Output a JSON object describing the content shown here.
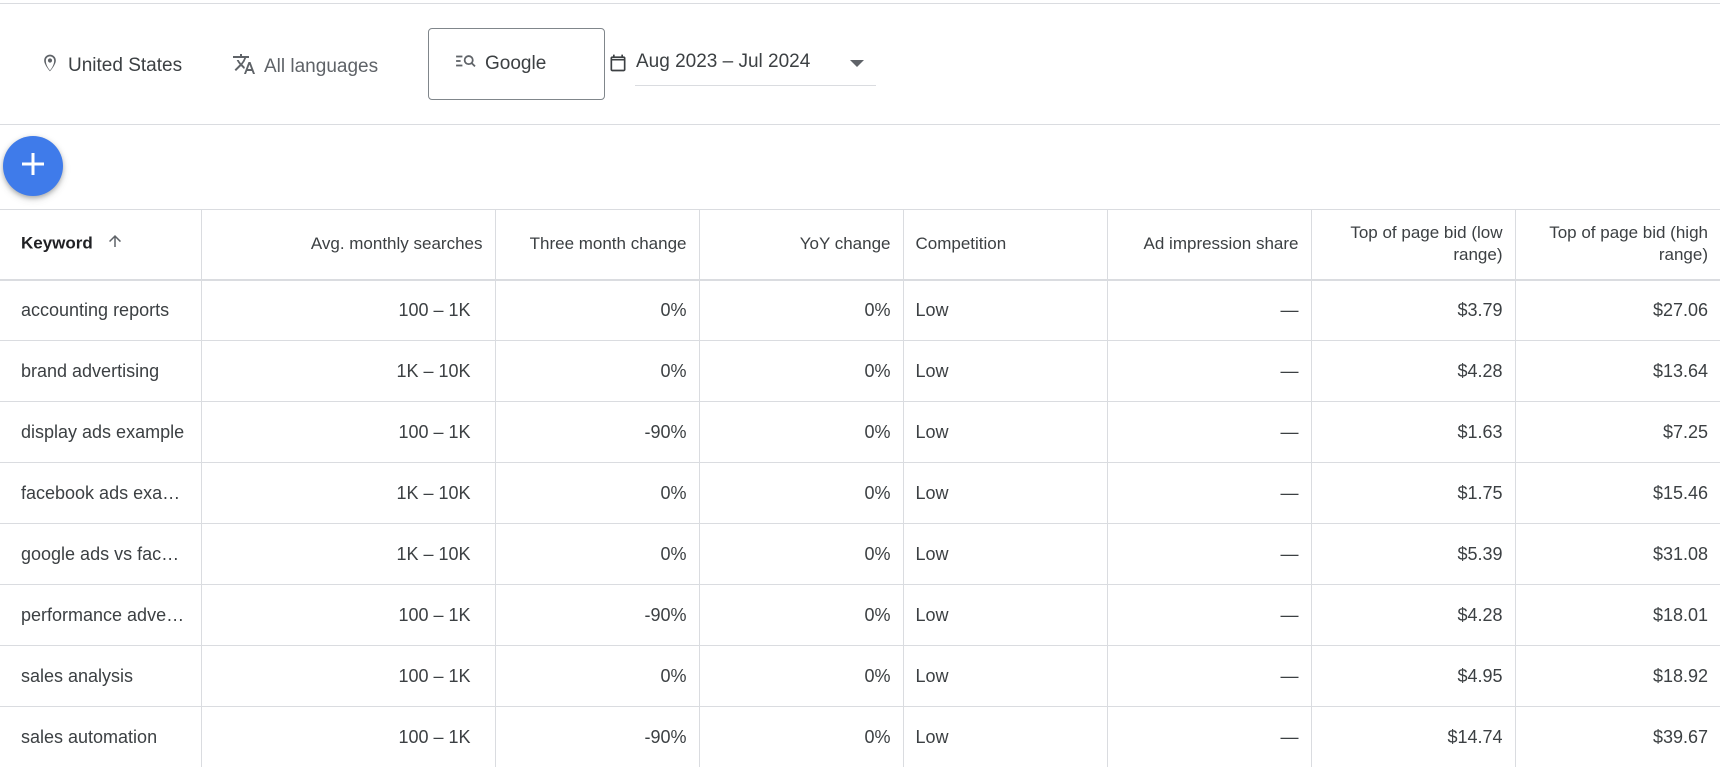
{
  "filters": {
    "location": "United States",
    "language": "All languages",
    "network": "Google",
    "date_range": "Aug 2023 – Jul 2024",
    "location_icon": "location-pin-icon",
    "language_icon": "translate-icon",
    "network_icon": "search-network-icon",
    "date_icon": "calendar-icon"
  },
  "fab": {
    "icon": "add-icon",
    "color": "#3f7bea"
  },
  "table": {
    "headers": [
      "Keyword",
      "Avg. monthly searches",
      "Three month change",
      "YoY change",
      "Competition",
      "Ad impression share",
      "Top of page bid (low range)",
      "Top of page bid (high range)"
    ],
    "sort_icon": "arrow-up-icon",
    "rows": [
      {
        "keyword": "accounting reports",
        "searches": "100 – 1K",
        "three_month": "0%",
        "yoy": "0%",
        "competition": "Low",
        "impression_share": "—",
        "bid_low": "$3.79",
        "bid_high": "$27.06"
      },
      {
        "keyword": "brand advertising",
        "searches": "1K – 10K",
        "three_month": "0%",
        "yoy": "0%",
        "competition": "Low",
        "impression_share": "—",
        "bid_low": "$4.28",
        "bid_high": "$13.64"
      },
      {
        "keyword": "display ads example",
        "searches": "100 – 1K",
        "three_month": "-90%",
        "yoy": "0%",
        "competition": "Low",
        "impression_share": "—",
        "bid_low": "$1.63",
        "bid_high": "$7.25"
      },
      {
        "keyword": "facebook ads exa…",
        "searches": "1K – 10K",
        "three_month": "0%",
        "yoy": "0%",
        "competition": "Low",
        "impression_share": "—",
        "bid_low": "$1.75",
        "bid_high": "$15.46"
      },
      {
        "keyword": "google ads vs face…",
        "searches": "1K – 10K",
        "three_month": "0%",
        "yoy": "0%",
        "competition": "Low",
        "impression_share": "—",
        "bid_low": "$5.39",
        "bid_high": "$31.08"
      },
      {
        "keyword": "performance adver…",
        "searches": "100 – 1K",
        "three_month": "-90%",
        "yoy": "0%",
        "competition": "Low",
        "impression_share": "—",
        "bid_low": "$4.28",
        "bid_high": "$18.01"
      },
      {
        "keyword": "sales analysis",
        "searches": "100 – 1K",
        "three_month": "0%",
        "yoy": "0%",
        "competition": "Low",
        "impression_share": "—",
        "bid_low": "$4.95",
        "bid_high": "$18.92"
      },
      {
        "keyword": "sales automation",
        "searches": "100 – 1K",
        "three_month": "-90%",
        "yoy": "0%",
        "competition": "Low",
        "impression_share": "—",
        "bid_low": "$14.74",
        "bid_high": "$39.67"
      }
    ]
  }
}
